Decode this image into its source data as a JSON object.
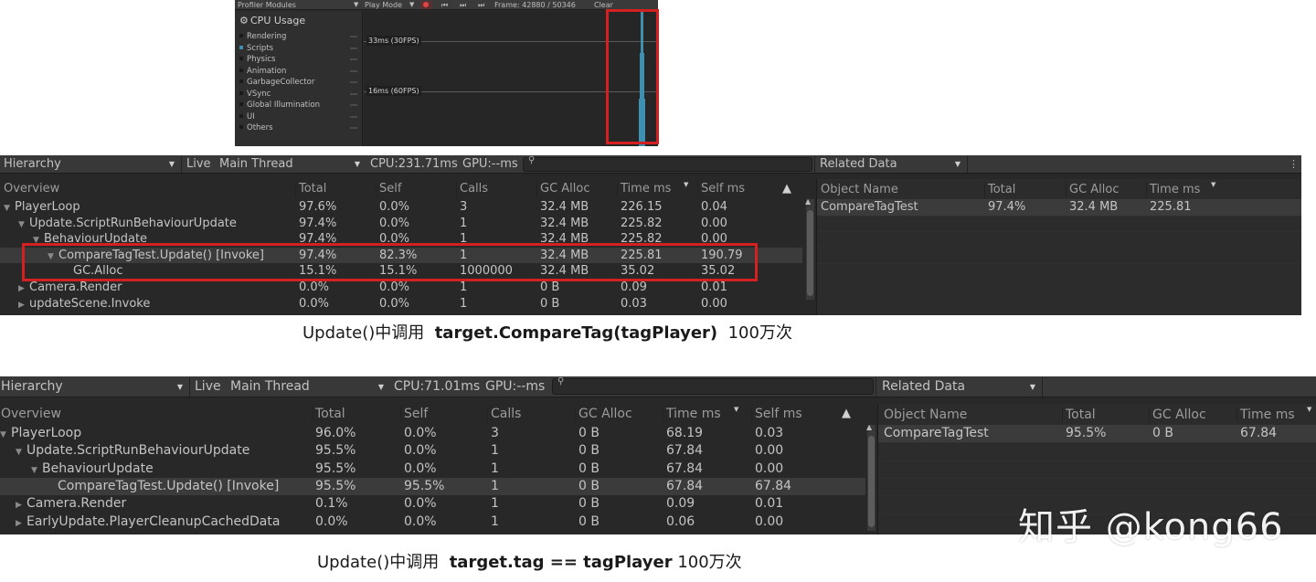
{
  "cpu_module": {
    "header_modules": "Profiler Modules",
    "play_mode": "Play Mode",
    "frame": "Frame: 42880 / 50346",
    "clear": "Clear",
    "title": "CPU Usage",
    "categories": [
      "Rendering",
      "Scripts",
      "Physics",
      "Animation",
      "GarbageCollector",
      "VSync",
      "Global Illumination",
      "UI",
      "Others"
    ],
    "line_30fps": "33ms (30FPS)",
    "line_60fps": "16ms (60FPS)",
    "colors": {
      "scripts": "#3f8fb0",
      "highlight": "#d42020"
    }
  },
  "panel1": {
    "view": "Hierarchy",
    "live": "Live",
    "thread": "Main Thread",
    "cpu": "CPU:231.71ms",
    "gpu": "GPU:--ms",
    "related": "Related Data",
    "columns": [
      "Overview",
      "Total",
      "Self",
      "Calls",
      "GC Alloc",
      "Time ms",
      "Self ms"
    ],
    "rows": [
      {
        "name": "PlayerLoop",
        "indent": 0,
        "arrow": "▼",
        "total": "97.6%",
        "self": "0.0%",
        "calls": "3",
        "gc": "32.4 MB",
        "time": "226.15",
        "selfms": "0.04"
      },
      {
        "name": "Update.ScriptRunBehaviourUpdate",
        "indent": 1,
        "arrow": "▼",
        "total": "97.4%",
        "self": "0.0%",
        "calls": "1",
        "gc": "32.4 MB",
        "time": "225.82",
        "selfms": "0.00"
      },
      {
        "name": "BehaviourUpdate",
        "indent": 2,
        "arrow": "▼",
        "total": "97.4%",
        "self": "0.0%",
        "calls": "1",
        "gc": "32.4 MB",
        "time": "225.82",
        "selfms": "0.00"
      },
      {
        "name": "CompareTagTest.Update() [Invoke]",
        "indent": 3,
        "arrow": "▼",
        "total": "97.4%",
        "self": "82.3%",
        "calls": "1",
        "gc": "32.4 MB",
        "time": "225.81",
        "selfms": "190.79"
      },
      {
        "name": "GC.Alloc",
        "indent": 4,
        "arrow": "",
        "total": "15.1%",
        "self": "15.1%",
        "calls": "1000000",
        "gc": "32.4 MB",
        "time": "35.02",
        "selfms": "35.02"
      },
      {
        "name": "Camera.Render",
        "indent": 1,
        "arrow": "▶",
        "total": "0.0%",
        "self": "0.0%",
        "calls": "1",
        "gc": "0 B",
        "time": "0.09",
        "selfms": "0.01"
      },
      {
        "name": "updateScene.Invoke",
        "indent": 1,
        "arrow": "▶",
        "total": "0.0%",
        "self": "0.0%",
        "calls": "1",
        "gc": "0 B",
        "time": "0.03",
        "selfms": "0.00"
      }
    ],
    "related_columns": [
      "Object Name",
      "Total",
      "GC Alloc",
      "Time ms"
    ],
    "related_row": {
      "name": "CompareTagTest",
      "total": "97.4%",
      "gc": "32.4 MB",
      "time": "225.81"
    }
  },
  "caption1": {
    "prefix": "Update()中调用",
    "code": "target.CompareTag(tagPlayer)",
    "suffix": "100万次"
  },
  "panel2": {
    "view": "Hierarchy",
    "live": "Live",
    "thread": "Main Thread",
    "cpu": "CPU:71.01ms",
    "gpu": "GPU:--ms",
    "related": "Related Data",
    "columns": [
      "Overview",
      "Total",
      "Self",
      "Calls",
      "GC Alloc",
      "Time ms",
      "Self ms"
    ],
    "rows": [
      {
        "name": "PlayerLoop",
        "indent": 0,
        "arrow": "▼",
        "total": "96.0%",
        "self": "0.0%",
        "calls": "3",
        "gc": "0 B",
        "time": "68.19",
        "selfms": "0.03"
      },
      {
        "name": "Update.ScriptRunBehaviourUpdate",
        "indent": 1,
        "arrow": "▼",
        "total": "95.5%",
        "self": "0.0%",
        "calls": "1",
        "gc": "0 B",
        "time": "67.84",
        "selfms": "0.00"
      },
      {
        "name": "BehaviourUpdate",
        "indent": 2,
        "arrow": "▼",
        "total": "95.5%",
        "self": "0.0%",
        "calls": "1",
        "gc": "0 B",
        "time": "67.84",
        "selfms": "0.00"
      },
      {
        "name": "CompareTagTest.Update() [Invoke]",
        "indent": 3,
        "arrow": "",
        "total": "95.5%",
        "self": "95.5%",
        "calls": "1",
        "gc": "0 B",
        "time": "67.84",
        "selfms": "67.84"
      },
      {
        "name": "Camera.Render",
        "indent": 1,
        "arrow": "▶",
        "total": "0.1%",
        "self": "0.0%",
        "calls": "1",
        "gc": "0 B",
        "time": "0.09",
        "selfms": "0.01"
      },
      {
        "name": "EarlyUpdate.PlayerCleanupCachedData",
        "indent": 1,
        "arrow": "▶",
        "total": "0.0%",
        "self": "0.0%",
        "calls": "1",
        "gc": "0 B",
        "time": "0.06",
        "selfms": "0.00"
      }
    ],
    "related_columns": [
      "Object Name",
      "Total",
      "GC Alloc",
      "Time ms"
    ],
    "related_row": {
      "name": "CompareTagTest",
      "total": "95.5%",
      "gc": "0 B",
      "time": "67.84"
    }
  },
  "caption2": {
    "prefix": "Update()中调用",
    "code": "target.tag == tagPlayer",
    "suffix": "100万次"
  },
  "watermark": "知乎 @kong66"
}
